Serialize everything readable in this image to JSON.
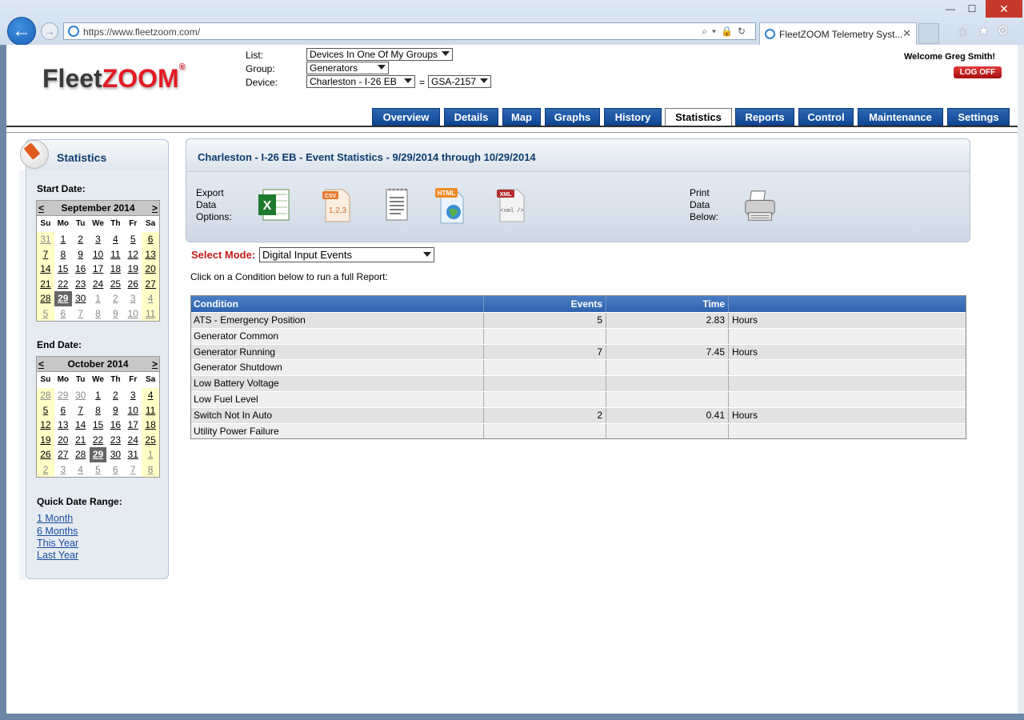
{
  "browser": {
    "url": "https://www.fleetzoom.com/",
    "tab_title": "FleetZOOM Telemetry Syst...",
    "close_glyph": "✕",
    "min_glyph": "—",
    "max_glyph": "☐"
  },
  "logo": {
    "part1": "Fleet",
    "part2": "ZOOM",
    "reg": "®"
  },
  "selectors": {
    "list_label": "List:",
    "list_value": "Devices In One Of My Groups",
    "group_label": "Group:",
    "group_value": "Generators",
    "device_label": "Device:",
    "device_value": "Charleston - I-26 EB",
    "equals": "=",
    "device_id_value": "GSA-2157"
  },
  "user": {
    "welcome": "Welcome Greg Smith!",
    "logoff": "LOG OFF"
  },
  "nav_tabs": [
    {
      "label": "Overview"
    },
    {
      "label": "Details"
    },
    {
      "label": "Map"
    },
    {
      "label": "Graphs"
    },
    {
      "label": "History"
    },
    {
      "label": "Statistics"
    },
    {
      "label": "Reports"
    },
    {
      "label": "Control"
    },
    {
      "label": "Maintenance"
    },
    {
      "label": "Settings"
    }
  ],
  "sidebar": {
    "title": "Statistics",
    "start_label": "Start Date:",
    "end_label": "End Date:",
    "quick_label": "Quick Date Range:",
    "quick_links": [
      {
        "label": "1 Month"
      },
      {
        "label": "6 Months"
      },
      {
        "label": "This Year"
      },
      {
        "label": "Last Year"
      }
    ],
    "cal_start": {
      "month": "September 2014",
      "prev": "<",
      "next": ">",
      "dow": [
        "Su",
        "Mo",
        "Tu",
        "We",
        "Th",
        "Fr",
        "Sa"
      ],
      "weeks": [
        [
          "31",
          "1",
          "2",
          "3",
          "4",
          "5",
          "6"
        ],
        [
          "7",
          "8",
          "9",
          "10",
          "11",
          "12",
          "13"
        ],
        [
          "14",
          "15",
          "16",
          "17",
          "18",
          "19",
          "20"
        ],
        [
          "21",
          "22",
          "23",
          "24",
          "25",
          "26",
          "27"
        ],
        [
          "28",
          "29",
          "30",
          "1",
          "2",
          "3",
          "4"
        ],
        [
          "5",
          "6",
          "7",
          "8",
          "9",
          "10",
          "11"
        ]
      ],
      "selected": "29"
    },
    "cal_end": {
      "month": "October 2014",
      "prev": "<",
      "next": ">",
      "dow": [
        "Su",
        "Mo",
        "Tu",
        "We",
        "Th",
        "Fr",
        "Sa"
      ],
      "weeks": [
        [
          "28",
          "29",
          "30",
          "1",
          "2",
          "3",
          "4"
        ],
        [
          "5",
          "6",
          "7",
          "8",
          "9",
          "10",
          "11"
        ],
        [
          "12",
          "13",
          "14",
          "15",
          "16",
          "17",
          "18"
        ],
        [
          "19",
          "20",
          "21",
          "22",
          "23",
          "24",
          "25"
        ],
        [
          "26",
          "27",
          "28",
          "29",
          "30",
          "31",
          "1"
        ],
        [
          "2",
          "3",
          "4",
          "5",
          "6",
          "7",
          "8"
        ]
      ],
      "selected": "29"
    }
  },
  "main": {
    "title": "Charleston - I-26 EB - Event Statistics - 9/29/2014 through 10/29/2014",
    "export_label": "Export Data Options:",
    "print_label": "Print Data Below:",
    "export_icons": [
      {
        "name": "excel-export-icon",
        "label": "X"
      },
      {
        "name": "csv-export-icon",
        "label": "CSV",
        "sub": "1,2,3"
      },
      {
        "name": "text-export-icon",
        "label": ""
      },
      {
        "name": "html-export-icon",
        "label": "HTML"
      },
      {
        "name": "xml-export-icon",
        "label": "XML",
        "sub": "<xml />"
      }
    ],
    "mode_label": "Select Mode:",
    "mode_value": "Digital Input Events",
    "instructions": "Click on a Condition below to run a full Report:",
    "table": {
      "headers": {
        "condition": "Condition",
        "events": "Events",
        "time": "Time",
        "unit": ""
      },
      "rows": [
        {
          "condition": "ATS - Emergency Position",
          "events": "5",
          "time": "2.83",
          "unit": "Hours"
        },
        {
          "condition": "Generator Common",
          "events": "",
          "time": "",
          "unit": ""
        },
        {
          "condition": "Generator Running",
          "events": "7",
          "time": "7.45",
          "unit": "Hours"
        },
        {
          "condition": "Generator Shutdown",
          "events": "",
          "time": "",
          "unit": ""
        },
        {
          "condition": "Low Battery Voltage",
          "events": "",
          "time": "",
          "unit": ""
        },
        {
          "condition": "Low Fuel Level",
          "events": "",
          "time": "",
          "unit": ""
        },
        {
          "condition": "Switch Not In Auto",
          "events": "2",
          "time": "0.41",
          "unit": "Hours"
        },
        {
          "condition": "Utility Power Failure",
          "events": "",
          "time": "",
          "unit": ""
        }
      ]
    }
  }
}
